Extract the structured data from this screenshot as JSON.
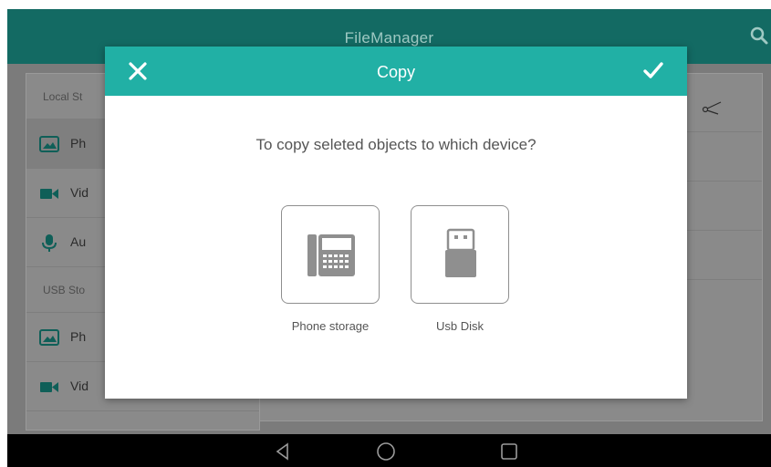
{
  "app": {
    "title": "FileManager",
    "search_icon": "search-icon",
    "accent_color": "#136a63"
  },
  "sidebar": {
    "local_header": "Local St",
    "usb_header": "USB Sto",
    "items": [
      {
        "label": "Ph",
        "icon": "image-icon"
      },
      {
        "label": "Vid",
        "icon": "video-icon"
      },
      {
        "label": "Au",
        "icon": "microphone-icon"
      },
      {
        "label": "Ph",
        "icon": "image-icon"
      },
      {
        "label": "Vid",
        "icon": "video-icon"
      }
    ]
  },
  "toolbar": {
    "cut_icon": "scissors-icon"
  },
  "dialog": {
    "title": "Copy",
    "header_color": "#21b0a5",
    "close_icon": "close-icon",
    "confirm_icon": "check-icon",
    "prompt": "To copy seleted objects to which device?",
    "options": [
      {
        "label": "Phone storage",
        "icon": "desk-phone-icon"
      },
      {
        "label": "Usb Disk",
        "icon": "usb-drive-icon"
      }
    ]
  },
  "system_nav": {
    "back_icon": "back-triangle-icon",
    "home_icon": "home-circle-icon",
    "recents_icon": "recents-square-icon"
  }
}
